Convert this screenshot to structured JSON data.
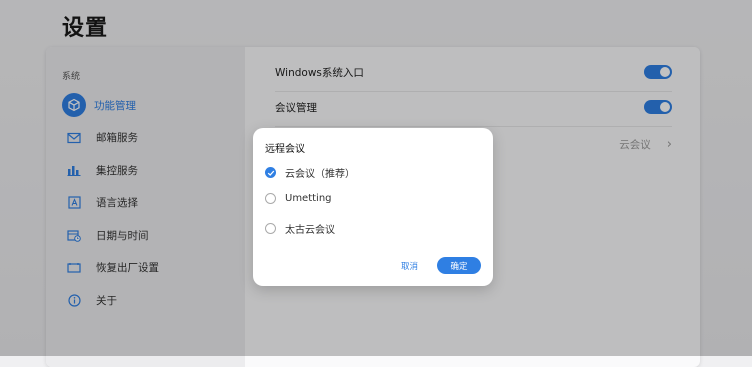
{
  "page_title": "设置",
  "sidebar": {
    "section_title": "系统",
    "items": [
      {
        "label": "功能管理",
        "icon": "cube-icon",
        "active": true
      },
      {
        "label": "邮箱服务",
        "icon": "mail-icon"
      },
      {
        "label": "集控服务",
        "icon": "bar-chart-icon"
      },
      {
        "label": "语言选择",
        "icon": "language-icon"
      },
      {
        "label": "日期与时间",
        "icon": "calendar-clock-icon"
      },
      {
        "label": "恢复出厂设置",
        "icon": "reset-screen-icon"
      },
      {
        "label": "关于",
        "icon": "info-icon"
      }
    ]
  },
  "settings": {
    "windows_entry": {
      "label": "Windows系统入口",
      "enabled": true
    },
    "meeting_mgmt": {
      "label": "会议管理",
      "enabled": true
    },
    "remote_meeting": {
      "value": "云会议"
    }
  },
  "dialog": {
    "title": "远程会议",
    "options": [
      {
        "label": "云会议（推荐）",
        "checked": true
      },
      {
        "label": "Umetting",
        "checked": false
      },
      {
        "label": "太古云会议",
        "checked": false
      }
    ],
    "cancel_label": "取消",
    "ok_label": "确定"
  },
  "colors": {
    "accent": "#2f7fe3"
  }
}
